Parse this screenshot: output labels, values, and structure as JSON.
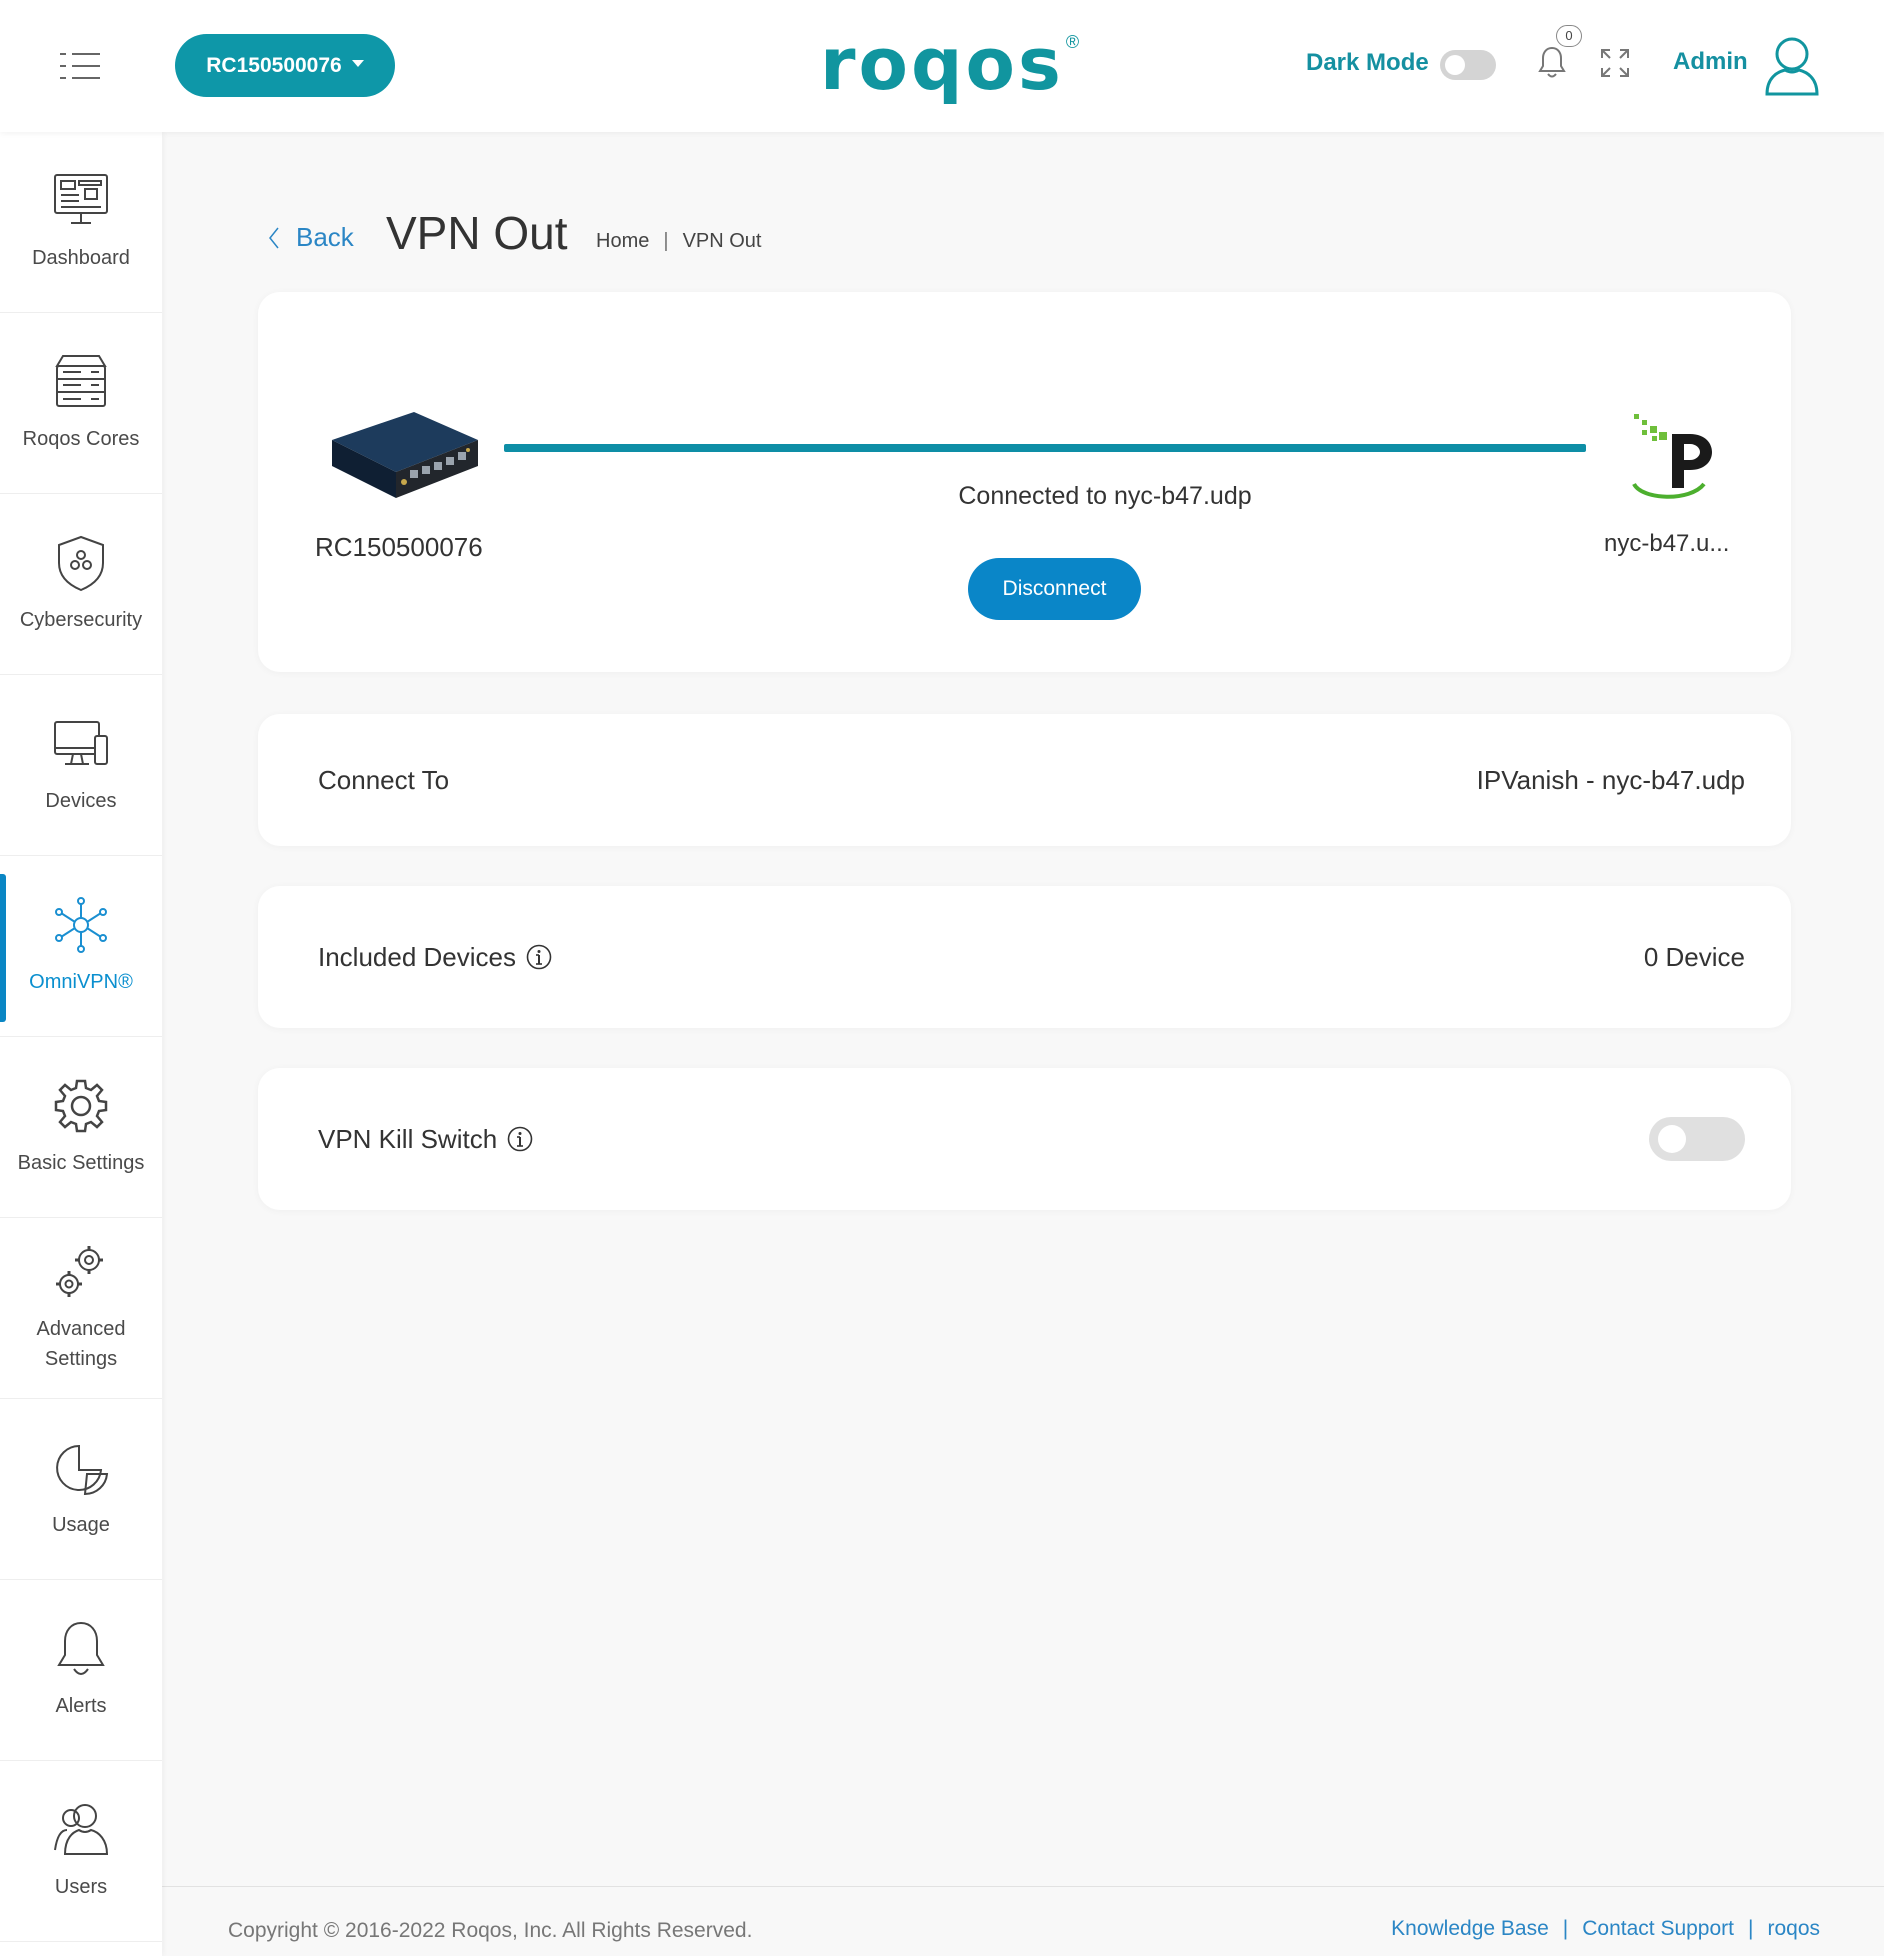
{
  "header": {
    "device_selector": "RC150500076",
    "logo_text": "roqos",
    "logo_mark": "®",
    "dark_mode_label": "Dark Mode",
    "notification_count": "0",
    "admin_label": "Admin",
    "brand_color": "#0e97a8"
  },
  "sidebar": {
    "items": [
      {
        "label": "Dashboard",
        "icon": "dashboard-icon"
      },
      {
        "label": "Roqos Cores",
        "icon": "server-icon"
      },
      {
        "label": "Cybersecurity",
        "icon": "shield-icon"
      },
      {
        "label": "Devices",
        "icon": "devices-icon"
      },
      {
        "label": "OmniVPN®",
        "icon": "network-icon",
        "active": true
      },
      {
        "label": "Basic Settings",
        "icon": "gear-icon"
      },
      {
        "label": "Advanced Settings",
        "icon": "gears-icon"
      },
      {
        "label": "Usage",
        "icon": "pie-chart-icon"
      },
      {
        "label": "Alerts",
        "icon": "bell-icon"
      },
      {
        "label": "Users",
        "icon": "users-icon"
      }
    ]
  },
  "page": {
    "back_label": "Back",
    "title": "VPN Out",
    "breadcrumb": [
      "Home",
      "VPN Out"
    ]
  },
  "connection": {
    "device_name": "RC150500076",
    "status": "Connected to nyc-b47.udp",
    "disconnect_label": "Disconnect",
    "server_name": "nyc-b47.u..."
  },
  "settings": {
    "connect_to_label": "Connect To",
    "connect_to_value": "IPVanish - nyc-b47.udp",
    "included_devices_label": "Included Devices",
    "included_devices_value": "0 Device",
    "kill_switch_label": "VPN Kill Switch"
  },
  "footer": {
    "copyright": "Copyright © 2016-2022 Roqos, Inc. All Rights Reserved.",
    "links": [
      "Knowledge Base",
      "Contact Support",
      "roqos"
    ]
  }
}
